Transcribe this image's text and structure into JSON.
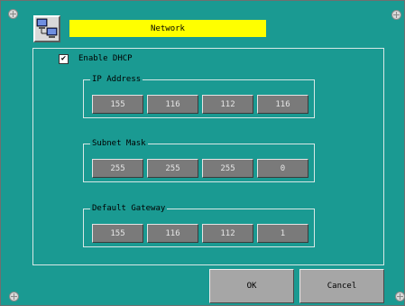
{
  "title": "Network",
  "app_icon": "network-computer-icon",
  "dhcp": {
    "label": "Enable DHCP",
    "checked": true,
    "check_glyph": "✔"
  },
  "groups": {
    "ip": {
      "title": "IP Address",
      "octets": [
        "155",
        "116",
        "112",
        "116"
      ]
    },
    "subnet": {
      "title": "Subnet Mask",
      "octets": [
        "255",
        "255",
        "255",
        "0"
      ]
    },
    "gateway": {
      "title": "Default Gateway",
      "octets": [
        "155",
        "116",
        "112",
        "1"
      ]
    }
  },
  "buttons": {
    "ok": "OK",
    "cancel": "Cancel"
  },
  "colors": {
    "background": "#1a9a92",
    "title_bar": "#ffff00",
    "octet_field": "#7a7a7a",
    "button": "#a6a6a6"
  }
}
